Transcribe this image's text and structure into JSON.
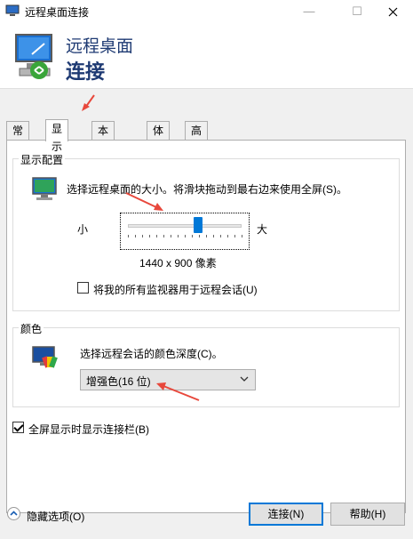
{
  "window": {
    "title": "远程桌面连接",
    "minimize_glyph": "—",
    "maximize_glyph": "☐"
  },
  "banner": {
    "line1": "远程桌面",
    "line2": "连接"
  },
  "tabs": [
    {
      "label": "常规",
      "active": false
    },
    {
      "label": "显示",
      "active": true
    },
    {
      "label": "本地资源",
      "active": false
    },
    {
      "label": "体验",
      "active": false
    },
    {
      "label": "高级",
      "active": false
    }
  ],
  "display_config": {
    "legend": "显示配置",
    "description": "选择远程桌面的大小。将滑块拖动到最右边来使用全屏(S)。",
    "small_label": "小",
    "large_label": "大",
    "resolution": "1440 x 900 像素",
    "slider_value_fraction": 0.62,
    "use_all_monitors_label": "将我的所有监视器用于远程会话(U)",
    "use_all_monitors_checked": false
  },
  "colors": {
    "legend": "颜色",
    "description": "选择远程会话的颜色深度(C)。",
    "selected_depth": "增强色(16 位)"
  },
  "show_connection_bar": {
    "label": "全屏显示时显示连接栏(B)",
    "checked": true
  },
  "footer": {
    "hide_options_label": "隐藏选项(O)",
    "connect_label": "连接(N)",
    "help_label": "帮助(H)"
  },
  "accent_colors": {
    "annotation_arrow": "#e8483c",
    "slider_thumb": "#0078d7",
    "title_text": "#1e3a73"
  }
}
